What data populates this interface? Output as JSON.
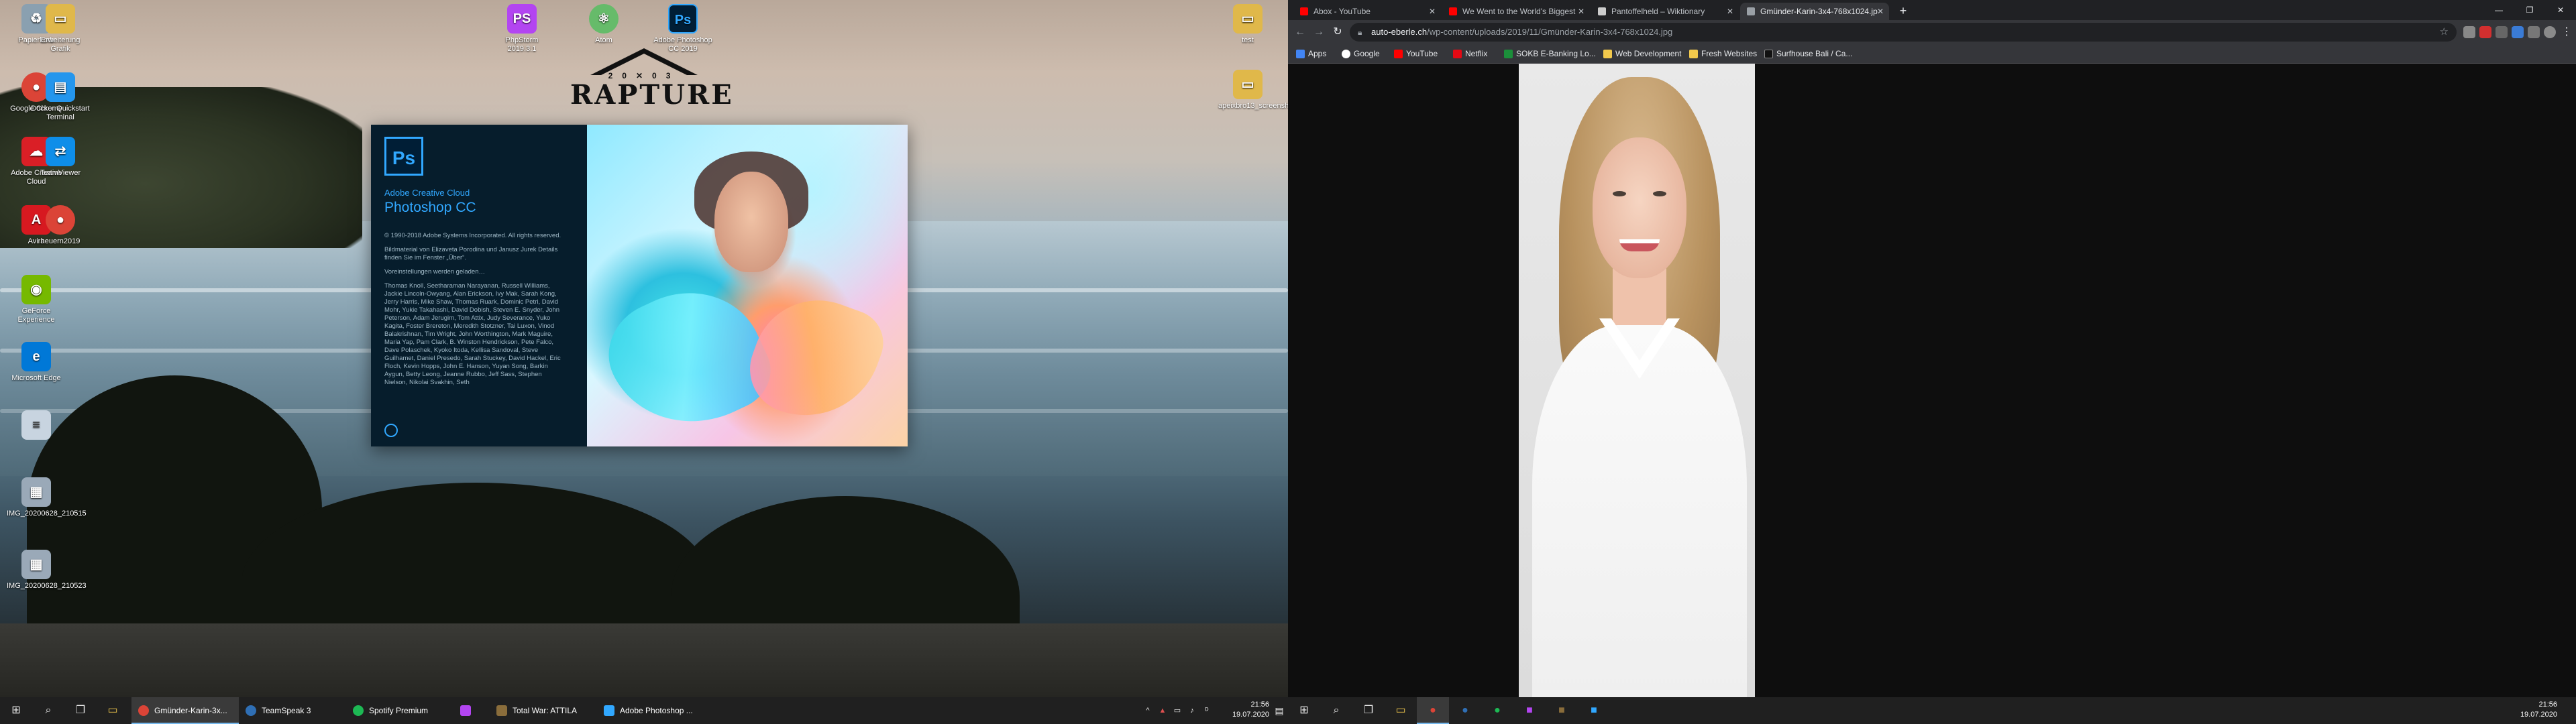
{
  "left_screen": {
    "desktop_icons": [
      {
        "label": "Papierkorb",
        "icon": "recycle-bin-icon",
        "color": "#8aa0b0"
      },
      {
        "label": "Erweiterung Grafik",
        "icon": "folder-icon",
        "color": "#e0b84a"
      },
      {
        "label": "Google Chrome",
        "icon": "chrome-icon",
        "color": "#db4437"
      },
      {
        "label": "Docker Quickstart Terminal",
        "icon": "docker-icon",
        "color": "#2496ed"
      },
      {
        "label": "Adobe Creative Cloud",
        "icon": "creative-cloud-icon",
        "color": "#da1f26"
      },
      {
        "label": "TeamViewer",
        "icon": "teamviewer-icon",
        "color": "#0e8ee9"
      },
      {
        "label": "Avira",
        "icon": "avira-icon",
        "color": "#d71920"
      },
      {
        "label": "heuern2019",
        "icon": "chrome-icon",
        "color": "#db4437"
      },
      {
        "label": "GeForce Experience",
        "icon": "nvidia-icon",
        "color": "#76b900"
      },
      {
        "label": "Microsoft Edge",
        "icon": "edge-icon",
        "color": "#0078d7"
      },
      {
        "label": "",
        "icon": "document-icon",
        "color": "#c8d4e0"
      },
      {
        "label": "IMG_20200628_210515",
        "icon": "image-file-icon",
        "color": "#9aa9b8"
      },
      {
        "label": "IMG_20200628_210523",
        "icon": "image-file-icon",
        "color": "#9aa9b8"
      },
      {
        "label": "PhpStorm 2019.3.1",
        "icon": "phpstorm-icon",
        "color": "#b345f1"
      },
      {
        "label": "Atom",
        "icon": "atom-icon",
        "color": "#66bb6a"
      },
      {
        "label": "Adobe Photoshop CC 2019",
        "icon": "photoshop-icon",
        "color": "#001e36"
      },
      {
        "label": "test",
        "icon": "folder-icon",
        "color": "#e0b84a"
      },
      {
        "label": "apeixbro13_screensh...",
        "icon": "folder-icon",
        "color": "#e0b84a"
      }
    ],
    "rapture_logo": {
      "year_left": "20",
      "year_right": "03",
      "word": "RAPTURE"
    },
    "splash": {
      "logo": "Ps",
      "brand": "Adobe Creative Cloud",
      "product": "Photoshop CC",
      "copyright": "© 1990-2018 Adobe Systems Incorporated. All rights reserved.",
      "artwork": "Bildmaterial von Elizaveta Porodina und Janusz Jurek Details finden Sie im Fenster „Über“.",
      "status": "Voreinstellungen werden geladen…",
      "credits": "Thomas Knoll, Seetharaman Narayanan, Russell Williams, Jackie Lincoln-Owyang, Alan Erickson, Ivy Mak, Sarah Kong, Jerry Harris, Mike Shaw, Thomas Ruark, Dominic Petri, David Mohr, Yukie Takahashi, David Dobish, Steven E. Snyder, John Peterson, Adam Jerugim, Tom Attix, Judy Severance, Yuko Kagita, Foster Brereton, Meredith Stotzner, Tai Luxon, Vinod Balakrishnan, Tim Wright, John Worthington, Mark Maguire, Maria Yap, Pam Clark, B. Winston Hendrickson, Pete Falco, Dave Polaschek, Kyoko Itoda, Kellisa Sandoval, Steve Guilhamet, Daniel Presedo, Sarah Stuckey, David Hackel, Eric Floch, Kevin Hopps, John E. Hanson, Yuyan Song, Barkin Aygun, Betty Leong, Jeanne Rubbo, Jeff Sass, Stephen Nielson, Nikolai Svakhin, Seth"
    },
    "taskbar": {
      "apps": [
        {
          "label": "Gmünder-Karin-3x...",
          "icon": "chrome-icon",
          "color": "#db4437",
          "active": true
        },
        {
          "label": "TeamSpeak 3",
          "icon": "teamspeak-icon",
          "color": "#2f6fb5",
          "active": false
        },
        {
          "label": "Spotify Premium",
          "icon": "spotify-icon",
          "color": "#1db954",
          "active": false
        },
        {
          "label": "",
          "icon": "phpstorm-icon",
          "color": "#b345f1",
          "active": false
        },
        {
          "label": "Total War: ATTILA",
          "icon": "game-icon",
          "color": "#8a6d3b",
          "active": false
        },
        {
          "label": "Adobe Photoshop ...",
          "icon": "photoshop-icon",
          "color": "#31a8ff",
          "active": false
        }
      ],
      "time": "21:56",
      "date": "19.07.2020"
    }
  },
  "right_screen": {
    "tabs": [
      {
        "label": "Abox - YouTube",
        "icon": "youtube-icon",
        "color": "#ff0000",
        "active": false
      },
      {
        "label": "We Went to the World's Biggest",
        "icon": "youtube-icon",
        "color": "#ff0000",
        "active": false
      },
      {
        "label": "Pantoffelheld – Wiktionary",
        "icon": "wikipedia-icon",
        "color": "#cccccc",
        "active": false
      },
      {
        "label": "Gmünder-Karin-3x4-768x1024.jp",
        "icon": "image-icon",
        "color": "#9aa0a6",
        "active": true
      }
    ],
    "url_host": "auto-eberle.ch",
    "url_path": "/wp-content/uploads/2019/11/Gmünder-Karin-3x4-768x1024.jpg",
    "bookmarks": [
      {
        "label": "Apps",
        "icon": "apps-icon",
        "color": "#4285f4"
      },
      {
        "label": "Google",
        "icon": "google-icon",
        "color": "#ffffff"
      },
      {
        "label": "YouTube",
        "icon": "youtube-icon",
        "color": "#ff0000"
      },
      {
        "label": "Netflix",
        "icon": "netflix-icon",
        "color": "#e50914"
      },
      {
        "label": "SOKB E-Banking Lo...",
        "icon": "bank-icon",
        "color": "#1b8f3a"
      },
      {
        "label": "Web Development",
        "icon": "folder-icon",
        "color": "#f2c94c"
      },
      {
        "label": "Fresh Websites",
        "icon": "folder-icon",
        "color": "#f2c94c"
      },
      {
        "label": "Surfhouse Bali / Ca...",
        "icon": "surf-icon",
        "color": "#111111"
      }
    ],
    "taskbar": {
      "time": "21:56",
      "date": "19.07.2020",
      "pinned": [
        {
          "icon": "windows-icon",
          "color": "#ffffff"
        },
        {
          "icon": "search-icon",
          "color": "#ffffff"
        },
        {
          "icon": "task-view-icon",
          "color": "#ffffff"
        },
        {
          "icon": "folder-icon",
          "color": "#f2c94c"
        },
        {
          "icon": "chrome-icon",
          "color": "#db4437"
        },
        {
          "icon": "teamspeak-icon",
          "color": "#2f6fb5"
        },
        {
          "icon": "spotify-icon",
          "color": "#1db954"
        },
        {
          "icon": "phpstorm-icon",
          "color": "#b345f1"
        },
        {
          "icon": "game-icon",
          "color": "#8a6d3b"
        },
        {
          "icon": "photoshop-icon",
          "color": "#31a8ff"
        }
      ]
    }
  }
}
